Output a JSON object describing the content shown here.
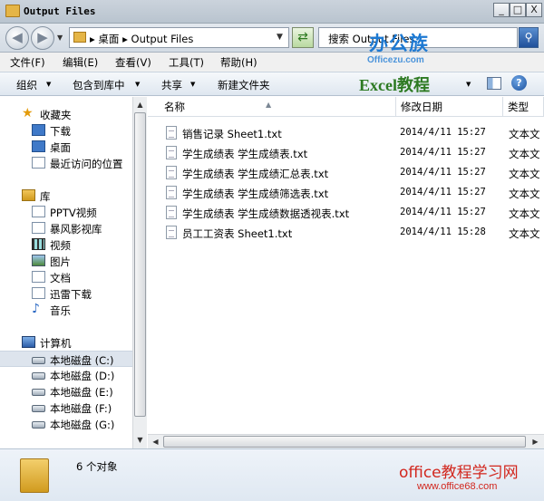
{
  "window": {
    "title": "Output Files",
    "controls": {
      "minimize": "_",
      "maximize": "□",
      "close": "X"
    }
  },
  "address": {
    "path": "▸ 桌面 ▸ Output Files",
    "search_text": "搜索 Output Files"
  },
  "menubar": [
    "文件(F)",
    "编辑(E)",
    "查看(V)",
    "工具(T)",
    "帮助(H)"
  ],
  "toolbar": {
    "organize": "组织",
    "include_library": "包含到库中",
    "share": "共享",
    "new_folder": "新建文件夹"
  },
  "watermark": {
    "logo_main": "办公族",
    "logo_sub": "Officezu.com",
    "logo_excel": "Excel教程",
    "bottom_main": "office教程学习网",
    "bottom_url": "www.office68.com"
  },
  "nav": {
    "favorites": {
      "label": "收藏夹",
      "items": [
        "下载",
        "桌面",
        "最近访问的位置"
      ]
    },
    "libraries": {
      "label": "库",
      "items": [
        "PPTV视频",
        "暴风影视库",
        "视频",
        "图片",
        "文档",
        "迅雷下载",
        "音乐"
      ]
    },
    "computer": {
      "label": "计算机",
      "items": [
        "本地磁盘 (C:)",
        "本地磁盘 (D:)",
        "本地磁盘 (E:)",
        "本地磁盘 (F:)",
        "本地磁盘 (G:)"
      ]
    }
  },
  "columns": {
    "name": "名称",
    "modified": "修改日期",
    "type": "类型"
  },
  "files": [
    {
      "name": "销售记录 Sheet1.txt",
      "modified": "2014/4/11 15:27",
      "type": "文本文"
    },
    {
      "name": "学生成绩表 学生成绩表.txt",
      "modified": "2014/4/11 15:27",
      "type": "文本文"
    },
    {
      "name": "学生成绩表 学生成绩汇总表.txt",
      "modified": "2014/4/11 15:27",
      "type": "文本文"
    },
    {
      "name": "学生成绩表 学生成绩筛选表.txt",
      "modified": "2014/4/11 15:27",
      "type": "文本文"
    },
    {
      "name": "学生成绩表 学生成绩数据透视表.txt",
      "modified": "2014/4/11 15:27",
      "type": "文本文"
    },
    {
      "name": "员工工资表 Sheet1.txt",
      "modified": "2014/4/11 15:28",
      "type": "文本文"
    }
  ],
  "status": {
    "count_text": "6 个对象"
  }
}
